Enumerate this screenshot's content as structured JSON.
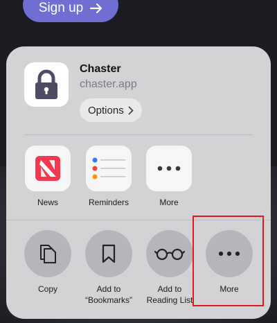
{
  "background": {
    "signup_label": "Sign up"
  },
  "sheet": {
    "app": {
      "name": "Chaster",
      "url": "chaster.app",
      "options_label": "Options"
    },
    "apps": [
      {
        "label": "News",
        "icon": "news-icon"
      },
      {
        "label": "Reminders",
        "icon": "reminders-icon"
      },
      {
        "label": "More",
        "icon": "more-icon"
      }
    ],
    "actions": [
      {
        "label": "Copy",
        "icon": "copy-icon"
      },
      {
        "label": "Add to\n“Bookmarks”",
        "icon": "bookmark-icon"
      },
      {
        "label": "Add to\nReading List",
        "icon": "glasses-icon"
      },
      {
        "label": "More",
        "icon": "more-icon"
      }
    ]
  },
  "colors": {
    "signup_button": "#6f6fd3",
    "sheet_bg": "#d3d3d6",
    "highlight": "#e0191c"
  }
}
